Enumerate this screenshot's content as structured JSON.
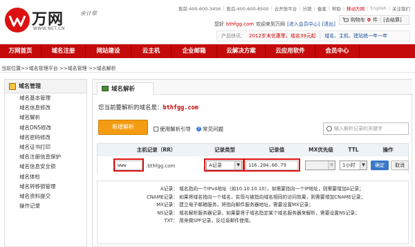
{
  "brand": {
    "name": "万网",
    "url": "WWW.NET.CN",
    "sign": "余计草"
  },
  "toplinks": [
    "售前:400-600-3456",
    "售后:400-600-8500",
    "云开放平台",
    "分销",
    "备案",
    "帮助",
    "移动万网",
    "English",
    "关注我们"
  ],
  "welcome": {
    "prefix": "您好",
    "user": "bthfgg.com",
    "suffix": "欢迎来到万网",
    "member_link": "[进入会员中心]",
    "logout": "[退出]"
  },
  "cart": {
    "label": "购物车",
    "count": "0",
    "unit": "件",
    "checkout": "[去结算]"
  },
  "quick": {
    "label": "产品快讯：",
    "highlight": "2012岁末优惠季，域名39元起",
    "link": "域名、主机、建站统一年一年"
  },
  "nav": [
    "万网首页",
    "域名注册",
    "网站建设",
    "云主机",
    "企业邮箱",
    "云解决方案",
    "云应用软件",
    "会员中心"
  ],
  "breadcrumb": "当前位置>>域名管理平台 >>域名管理 >>域名解析",
  "sidebar": {
    "title": "域名管理",
    "items": [
      "域名基本管理",
      "域名信息修改",
      "域名解析",
      "域名DNS修改",
      "域名密码修改",
      "域名证书打印",
      "域名注册信息保护",
      "域名信息安全锁",
      "域名体检",
      "域名转移锁管理",
      "域名资料提交",
      "操作记录"
    ]
  },
  "main": {
    "tab": "域名解析",
    "domain_prefix": "您当前要解析的域名是：",
    "domain": "bthfgg.com",
    "add_button": "新增解析",
    "guide": "使用解析引导",
    "faq": "常见问题",
    "search_placeholder": "输入解析记录的关键字"
  },
  "table": {
    "headers": [
      "主机记录（RR）",
      "记录类型",
      "记录值",
      "MX优先级",
      "TTL",
      "操作"
    ],
    "host_value": "www",
    "host_suffix": ".bthfgg.com",
    "type_value": "A记录",
    "record_value": "116.204.66.79",
    "mx_value": "",
    "ttl_value": "1小时",
    "ok": "确定",
    "cancel": "取消"
  },
  "help": [
    {
      "k": "A记录：",
      "v": "域名指向一个IPv4地址（如10.10.10.10），如需要指向一个IP地址，则需要增加A记录；"
    },
    {
      "k": "CNAME记录：",
      "v": "如果将域名指向一个域名，实现与被指向域名相同的访问效果，则需要增加CNAME记录；"
    },
    {
      "k": "MX记录：",
      "v": "建立电子邮箱服务，将指向邮件服务器地址，需要设置MX记录；"
    },
    {
      "k": "NS记录：",
      "v": "域名解析服务器记录，如果要将子域名指定某个域名服务器来解析，需要设置NS记录；"
    },
    {
      "k": "TXT：",
      "v": "用来做SPF记录，反垃圾邮件使用。"
    }
  ],
  "colors": {
    "nav": "#c40a0a",
    "accent": "#f39c12",
    "highlight_box": "#dd1111"
  }
}
